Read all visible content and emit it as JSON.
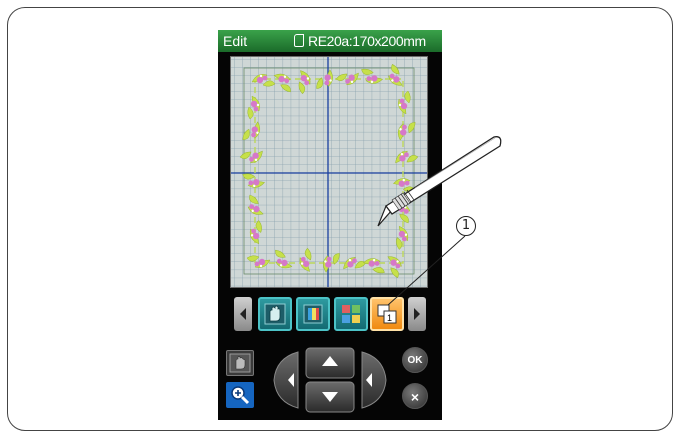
{
  "window": {
    "mode_title": "Edit",
    "hoop_label": "RE20a:170x200mm"
  },
  "toolbar": {
    "icons": [
      "hand-move-icon",
      "color-change-icon",
      "color-grouping-icon",
      "single-color-icon"
    ],
    "selected_index": 3
  },
  "controls": {
    "ok_label": "OK",
    "cancel_symbol": "×"
  },
  "callout": {
    "number": "1"
  },
  "colors": {
    "title_green": "#2a8a3a",
    "grid_line": "#8fa7b3",
    "center_line": "#1a3fa0",
    "motif_green": "#c6e04a",
    "flower_pink": "#d678c9",
    "button_teal": "#1f7d86",
    "button_orange": "#f39a1e"
  }
}
